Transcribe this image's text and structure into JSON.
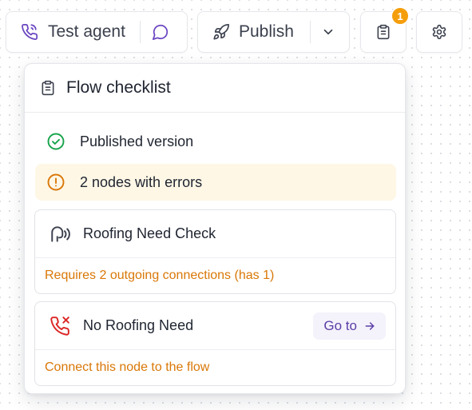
{
  "toolbar": {
    "test_agent_label": "Test agent",
    "publish_label": "Publish",
    "checklist_badge_count": "1"
  },
  "checklist": {
    "title": "Flow checklist",
    "status_items": [
      {
        "label": "Published version",
        "status": "success"
      },
      {
        "label": "2 nodes with errors",
        "status": "warning"
      }
    ],
    "nodes": [
      {
        "name": "Roofing Need Check",
        "icon": "voice-listen-icon",
        "error": "Requires 2 outgoing connections (has 1)"
      },
      {
        "name": "No Roofing Need",
        "icon": "phone-hangup-icon",
        "error": "Connect this node to the flow",
        "action_label": "Go to"
      }
    ]
  },
  "colors": {
    "accent_purple": "#6b46c1",
    "success_green": "#16a34a",
    "warning_amber": "#d97706",
    "badge_orange": "#f59e0b",
    "error_red": "#dc2626"
  }
}
